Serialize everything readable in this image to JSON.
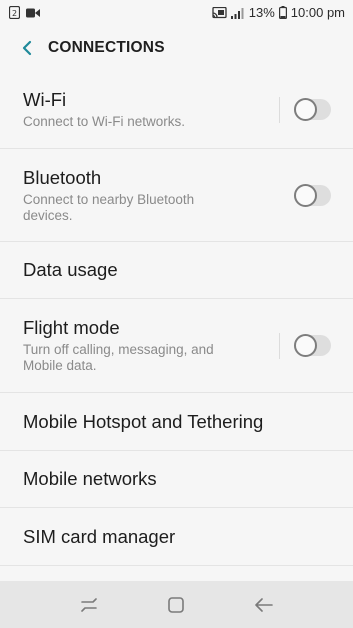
{
  "status_bar": {
    "battery_percent": "13%",
    "time": "10:00 pm",
    "icons": [
      "sim-icon",
      "video-icon",
      "cast-icon",
      "signal-icon",
      "battery-icon"
    ]
  },
  "header": {
    "title": "CONNECTIONS",
    "back_icon": "back-arrow-icon"
  },
  "settings": [
    {
      "title": "Wi-Fi",
      "subtitle": "Connect to Wi-Fi networks.",
      "toggle": false
    },
    {
      "title": "Bluetooth",
      "subtitle_line1": "Connect to nearby Bluetooth",
      "subtitle_line2": "devices.",
      "toggle": false
    },
    {
      "title": "Data usage"
    },
    {
      "title": "Flight mode",
      "subtitle_line1": "Turn off calling, messaging, and",
      "subtitle_line2": "Mobile data.",
      "toggle": false
    },
    {
      "title": "Mobile Hotspot and Tethering"
    },
    {
      "title": "Mobile networks"
    },
    {
      "title": "SIM card manager"
    }
  ],
  "nav_bar": {
    "icons": [
      "recent-apps-icon",
      "home-icon",
      "back-icon"
    ]
  },
  "colors": {
    "accent": "#1f8a9a",
    "background": "#f6f6f6",
    "nav_background": "#e6e6e6"
  }
}
